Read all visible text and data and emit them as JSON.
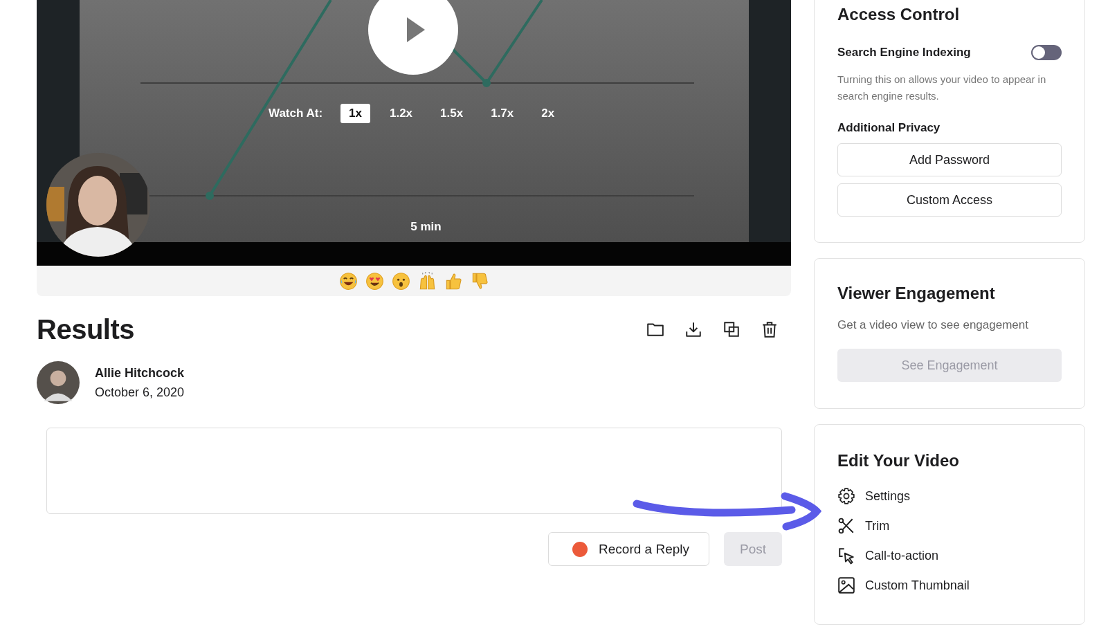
{
  "video": {
    "kind": "picture",
    "watch_label": "Watch At:",
    "speeds": [
      {
        "label": "1x",
        "selected": true
      },
      {
        "label": "1.2x",
        "selected": false
      },
      {
        "label": "1.5x",
        "selected": false
      },
      {
        "label": "1.7x",
        "selected": false
      },
      {
        "label": "2x",
        "selected": false
      }
    ],
    "duration": "5 min"
  },
  "results": {
    "title": "Results",
    "author": "Allie Hitchcock",
    "date": "October 6, 2020"
  },
  "reply": {
    "record_button": "Record a Reply",
    "post_button": {
      "label": "Post",
      "disabled": true
    }
  },
  "access_control": {
    "title": "Access Control",
    "indexing": {
      "label": "Search Engine Indexing",
      "on": false
    },
    "hint": "Turning this on allows your video to appear in search engine results.",
    "privacy_title": "Additional Privacy",
    "buttons": [
      "Add Password",
      "Custom Access"
    ]
  },
  "engagement": {
    "title": "Viewer Engagement",
    "text": "Get a video view to see engagement",
    "button": {
      "label": "See Engagement",
      "disabled": true
    }
  },
  "edit": {
    "title": "Edit Your Video",
    "items": [
      {
        "kind": "settings",
        "label": "Settings"
      },
      {
        "kind": "trim",
        "label": "Trim"
      },
      {
        "kind": "cta",
        "label": "Call-to-action"
      },
      {
        "kind": "thumbnail",
        "label": "Custom Thumbnail"
      }
    ]
  }
}
